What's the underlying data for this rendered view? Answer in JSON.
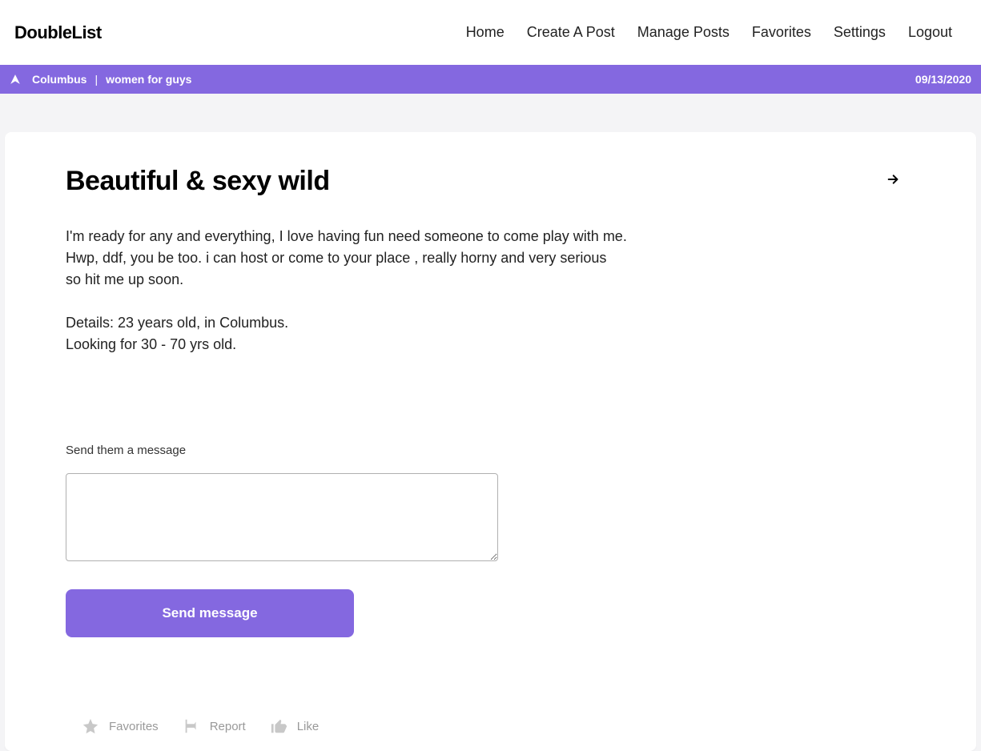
{
  "logo": "DoubleList",
  "nav": {
    "home": "Home",
    "create": "Create A Post",
    "manage": "Manage Posts",
    "favorites": "Favorites",
    "settings": "Settings",
    "logout": "Logout"
  },
  "subheader": {
    "location": "Columbus",
    "category": "women for guys",
    "date": "09/13/2020"
  },
  "post": {
    "title": "Beautiful & sexy wild",
    "body": "I'm ready for any and everything, I love having fun need someone to come play with me.\nHwp, ddf, you be too. i can host or come to your place , really horny and very serious\nso hit me up soon.\n\nDetails: 23 years old, in Columbus.\nLooking for 30 - 70 yrs old."
  },
  "message": {
    "label": "Send them a message",
    "send_btn": "Send message"
  },
  "actions": {
    "favorites": "Favorites",
    "report": "Report",
    "like": "Like"
  }
}
